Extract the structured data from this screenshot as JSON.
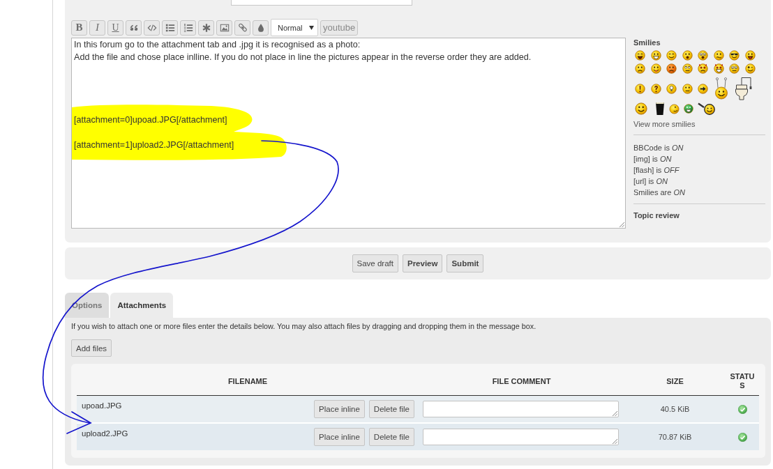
{
  "editor": {
    "format_buttons": [
      {
        "label": "B",
        "kind": "bold"
      },
      {
        "label": "I",
        "kind": "italic"
      },
      {
        "label": "U",
        "kind": "underline"
      }
    ],
    "size_select": "Normal",
    "youtube_button": "youtube",
    "message": "In this forum go to the attachment tab and .jpg it is recognised as a photo:\nAdd the file and chose place inlline. If you do not place in line the pictures appear in the reverse order they are added.\n\n\n\n\n[attachment=0]upoad.JPG[/attachment]\n\n[attachment=1]upload2.JPG[/attachment]"
  },
  "sidebar": {
    "title": "Smilies",
    "more_link": "View more smilies",
    "settings": [
      "BBCode is *ON*",
      "[img] is *ON*",
      "[flash] is *OFF*",
      "[url] is *ON*",
      "Smilies are *ON*"
    ],
    "topic_review": "Topic review"
  },
  "actions": [
    {
      "label": "Save draft",
      "primary": false
    },
    {
      "label": "Preview",
      "primary": true
    },
    {
      "label": "Submit",
      "primary": true
    }
  ],
  "tabs": [
    {
      "label": "Options",
      "selected": false
    },
    {
      "label": "Attachments",
      "selected": true
    }
  ],
  "attachments": {
    "hint": "If you wish to attach one or more files enter the details below. You may also attach files by dragging and dropping them in the message box.",
    "add_button": "Add files",
    "columns": [
      "FILENAME",
      "FILE COMMENT",
      "SIZE",
      "STATUS"
    ],
    "rows": [
      {
        "filename": "upoad.JPG",
        "buttons": [
          "Place inline",
          "Delete file"
        ],
        "size": "40.5 KiB",
        "uploaded": true
      },
      {
        "filename": "upload2.JPG",
        "buttons": [
          "Place inline",
          "Delete file"
        ],
        "size": "70.87 KiB",
        "uploaded": true
      }
    ]
  }
}
